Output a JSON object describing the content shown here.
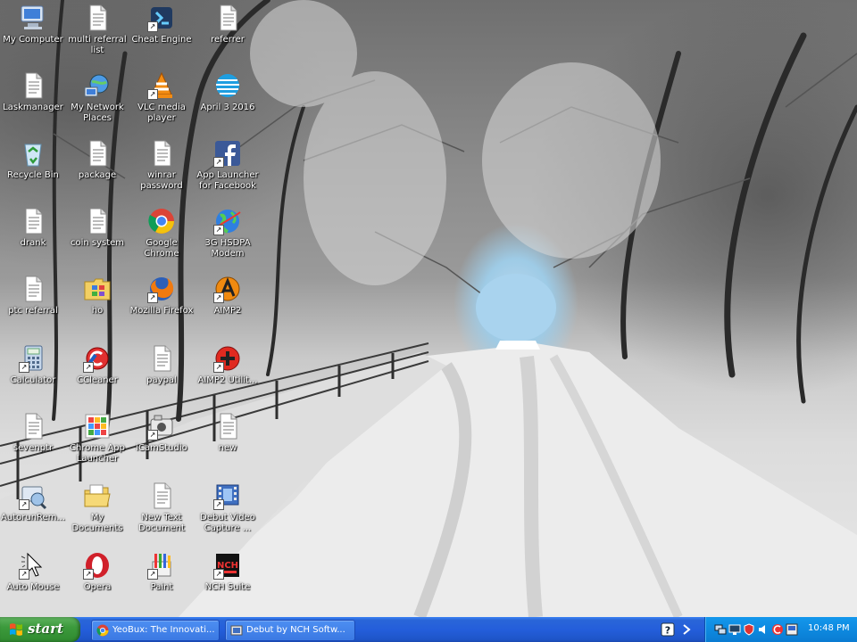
{
  "desktop_icons": [
    {
      "label": "My Computer",
      "icon": "my-computer-icon"
    },
    {
      "label": "Laskmanager",
      "icon": "text-file-icon"
    },
    {
      "label": "Recycle Bin",
      "icon": "recycle-bin-icon"
    },
    {
      "label": "drank",
      "icon": "text-file-icon"
    },
    {
      "label": "ptc referral",
      "icon": "text-file-icon"
    },
    {
      "label": "Calculator",
      "icon": "calculator-icon"
    },
    {
      "label": "sevenptr",
      "icon": "text-file-icon"
    },
    {
      "label": "AutorunRem...",
      "icon": "autorun-remover-icon"
    },
    {
      "label": "Auto Mouse",
      "icon": "mouse-cursor-icon"
    },
    {
      "label": "multi referral list",
      "icon": "text-file-icon"
    },
    {
      "label": "My Network Places",
      "icon": "network-places-icon"
    },
    {
      "label": "package",
      "icon": "text-file-icon"
    },
    {
      "label": "coin system",
      "icon": "text-file-icon"
    },
    {
      "label": "ho",
      "icon": "folder-icon"
    },
    {
      "label": "CCleaner",
      "icon": "ccleaner-icon"
    },
    {
      "label": "Chrome App Launcher",
      "icon": "app-launcher-icon"
    },
    {
      "label": "My Documents",
      "icon": "my-documents-icon"
    },
    {
      "label": "Opera",
      "icon": "opera-icon"
    },
    {
      "label": "Cheat Engine",
      "icon": "cheat-engine-icon"
    },
    {
      "label": "VLC media player",
      "icon": "vlc-icon"
    },
    {
      "label": "winrar password",
      "icon": "text-file-icon"
    },
    {
      "label": "Google Chrome",
      "icon": "chrome-icon"
    },
    {
      "label": "Mozilla Firefox",
      "icon": "firefox-icon"
    },
    {
      "label": "paypal",
      "icon": "text-file-icon"
    },
    {
      "label": "iCamStudio",
      "icon": "camstudio-icon"
    },
    {
      "label": "New Text Document",
      "icon": "text-file-icon"
    },
    {
      "label": "Paint",
      "icon": "paint-icon"
    },
    {
      "label": "referrer",
      "icon": "text-file-icon"
    },
    {
      "label": "April 3 2016",
      "icon": "att-icon"
    },
    {
      "label": "App Launcher for Facebook",
      "icon": "facebook-icon"
    },
    {
      "label": "3G HSDPA Modem",
      "icon": "modem-globe-icon"
    },
    {
      "label": "AIMP2",
      "icon": "aimp-icon"
    },
    {
      "label": "AIMP2 Utilit...",
      "icon": "aimp-utility-icon"
    },
    {
      "label": "new",
      "icon": "text-file-icon"
    },
    {
      "label": "Debut Video Capture ...",
      "icon": "debut-icon"
    },
    {
      "label": "NCH Suite",
      "icon": "nch-icon"
    }
  ],
  "taskbar": {
    "start_label": "start",
    "tasks": [
      {
        "label": "YeoBux: The Innovati...",
        "icon": "chrome-icon"
      },
      {
        "label": "Debut by NCH Softw...",
        "icon": "debut-window-icon"
      }
    ],
    "clock": "10:48 PM"
  },
  "colors": {
    "taskbar_blue": "#245edb",
    "start_green": "#3c9a3c",
    "tray_blue": "#0e8ae0"
  }
}
